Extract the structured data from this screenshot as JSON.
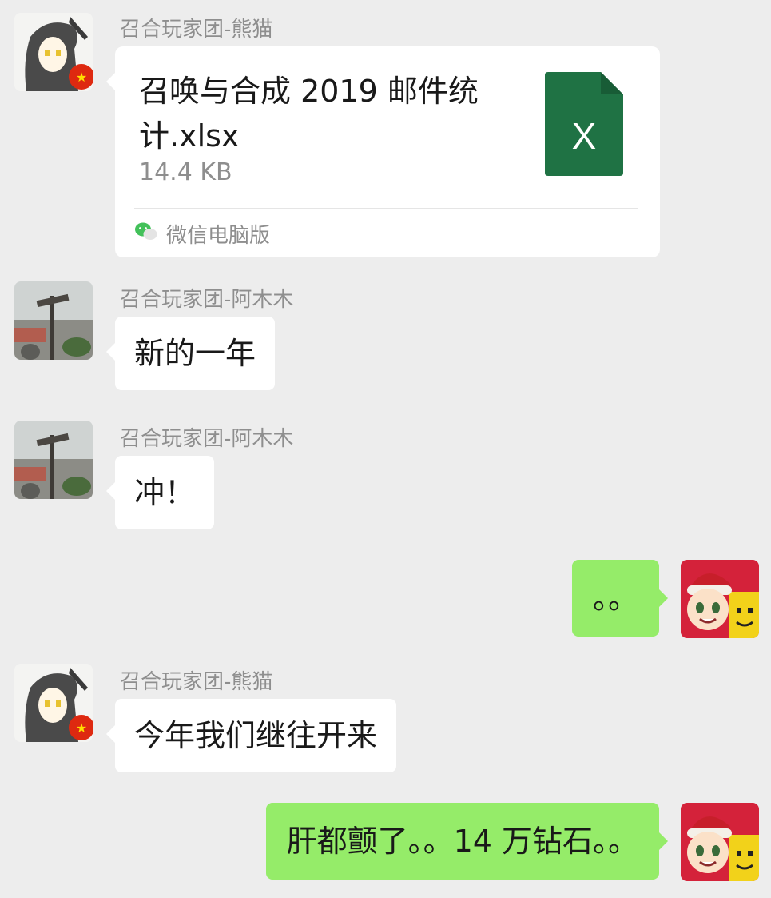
{
  "messages": [
    {
      "sender": "召合玩家团-熊猫",
      "type": "file",
      "file_name": "召唤与合成 2019 邮件统计.xlsx",
      "file_size": "14.4 KB",
      "file_icon": "excel-icon",
      "file_icon_letter": "X",
      "source": "微信电脑版",
      "source_icon": "wechat-icon"
    },
    {
      "sender": "召合玩家团-阿木木",
      "type": "text",
      "text": "新的一年"
    },
    {
      "sender": "召合玩家团-阿木木",
      "type": "text",
      "text": "冲！"
    },
    {
      "sender": "",
      "type": "text",
      "outgoing": true,
      "text": "。。"
    },
    {
      "sender": "召合玩家团-熊猫",
      "type": "text",
      "text": "今年我们继往开来"
    },
    {
      "sender": "",
      "type": "text",
      "outgoing": true,
      "text": "肝都颤了。。14 万钻石。。"
    }
  ],
  "colors": {
    "background": "#ededed",
    "incoming_bubble": "#ffffff",
    "outgoing_bubble": "#95ec69",
    "excel_green": "#1f7244"
  }
}
